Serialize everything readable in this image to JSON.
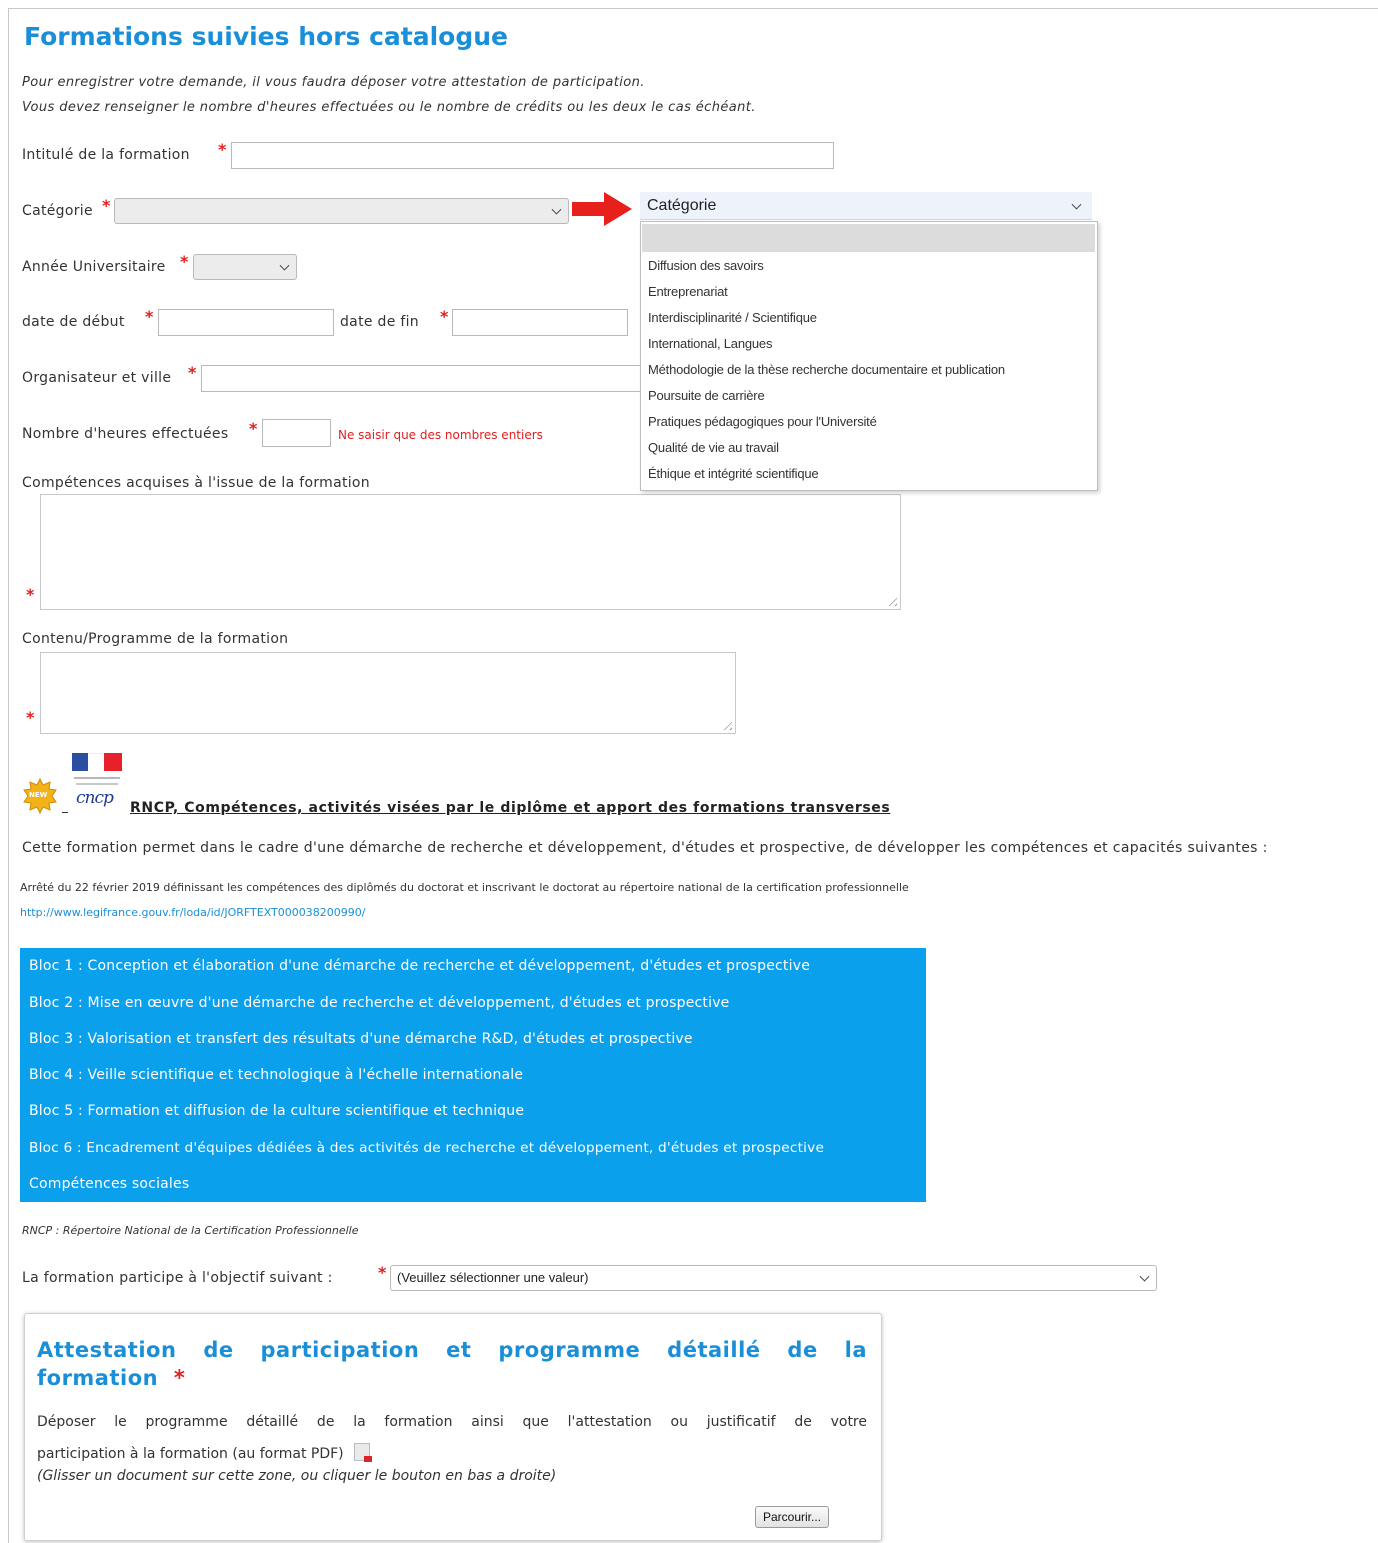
{
  "page": {
    "title": "Formations suivies hors catalogue",
    "intro_line1": "Pour enregistrer votre demande, il vous faudra déposer votre attestation de participation.",
    "intro_line2": "Vous devez renseigner le nombre d'heures effectuées ou le nombre de crédits ou les deux le cas échéant."
  },
  "form": {
    "required_mark": "*",
    "intitule_label": "Intitulé de la formation",
    "categorie_label": "Catégorie",
    "annee_label": "Année Universitaire",
    "date_debut_label": "date de début",
    "date_fin_label": "date de fin",
    "organisateur_label": "Organisateur et ville",
    "heures_label": "Nombre d'heures effectuées",
    "heures_hint": "Ne saisir que des nombres entiers",
    "competences_label": "Compétences acquises à l'issue de la formation",
    "contenu_label": "Contenu/Programme de la formation"
  },
  "dropdown": {
    "header": "Catégorie",
    "options": [
      "Diffusion des savoirs",
      "Entreprenariat",
      "Interdisciplinarité / Scientifique",
      "International, Langues",
      "Méthodologie de la thèse recherche documentaire et publication",
      "Poursuite de carrière",
      "Pratiques pédagogiques pour l'Université",
      "Qualité de vie au travail",
      "Éthique et intégrité scientifique"
    ]
  },
  "rncp": {
    "badge_text": "NEW",
    "logo_text": "cncp",
    "heading": "RNCP, Compétences, activités visées par le diplôme et apport des formations transverses",
    "description": "Cette formation permet dans le cadre d'une démarche de recherche et développement, d'études et prospective, de développer les compétences et capacités suivantes :",
    "arrete": "Arrêté du 22 février 2019 définissant les compétences des diplômés du doctorat et inscrivant le doctorat au répertoire national de la certification professionnelle",
    "link": "http://www.legifrance.gouv.fr/loda/id/JORFTEXT000038200990/",
    "blocs": [
      "Bloc 1 : Conception et élaboration d'une démarche de recherche et développement, d'études et prospective",
      "Bloc 2 : Mise en œuvre d'une démarche de recherche et développement, d'études et prospective",
      "Bloc 3 : Valorisation et transfert des résultats d'une démarche R&D, d'études et prospective",
      "Bloc 4 : Veille scientifique et technologique à l'échelle internationale",
      "Bloc 5 : Formation et diffusion de la culture scientifique et technique",
      "Bloc 6 : Encadrement d'équipes dédiées à des activités de recherche et développement, d'études et prospective",
      "Compétences sociales"
    ],
    "footnote": "RNCP : Répertoire National de la Certification Professionnelle"
  },
  "objectif": {
    "label": "La formation participe à l'objectif suivant :",
    "select_value": "(Veuillez sélectionner une valeur)"
  },
  "attestation": {
    "title_line1": "Attestation de participation et programme détaillé de la",
    "title_line2": "formation",
    "text_line1": "Déposer le programme détaillé de la formation ainsi que l'attestation ou justificatif de votre",
    "text_line2": "participation à la formation (au format PDF)",
    "hint": "(Glisser un document sur cette zone, ou cliquer le bouton en bas a droite)",
    "button": "Parcourir..."
  },
  "colors": {
    "accent": "#1a8fd8",
    "required": "#e02020",
    "bloc_bg": "#0aa0ec"
  }
}
